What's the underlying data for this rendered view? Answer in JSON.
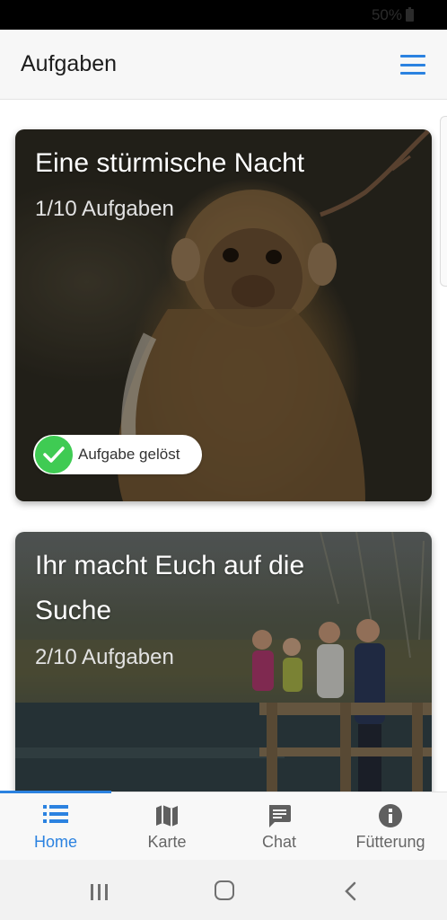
{
  "status_bar": {
    "battery_text": "50%"
  },
  "header": {
    "title": "Aufgaben",
    "menu_icon": "hamburger-menu-icon",
    "accent_color": "#2b82e0"
  },
  "cards": [
    {
      "title": "Eine stürmische Nacht",
      "progress": "1/10 Aufgaben",
      "badge": {
        "label": "Aufgabe gelöst",
        "color": "#3fcb53"
      }
    },
    {
      "title": "Ihr macht Euch auf die Suche",
      "progress": "2/10 Aufgaben"
    }
  ],
  "tabs": [
    {
      "label": "Home",
      "icon": "list-icon",
      "active": true
    },
    {
      "label": "Karte",
      "icon": "map-icon",
      "active": false
    },
    {
      "label": "Chat",
      "icon": "chat-icon",
      "active": false
    },
    {
      "label": "Fütterung",
      "icon": "info-icon",
      "active": false
    }
  ],
  "system_nav": {
    "recents_icon": "recents-icon",
    "home_icon": "home-icon",
    "back_icon": "back-icon"
  }
}
